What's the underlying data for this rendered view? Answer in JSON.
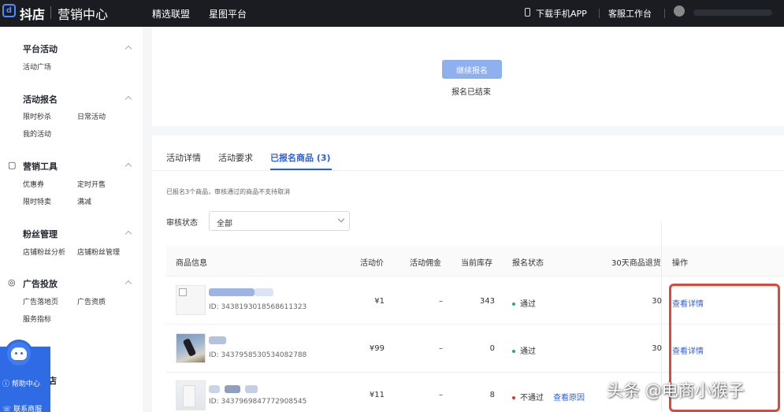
{
  "topbar": {
    "brand": "抖店",
    "brand_logo_char": "d",
    "section": "营销中心",
    "nav": [
      "精选联盟",
      "星图平台"
    ],
    "download_app": "下载手机APP",
    "service_desk": "客服工作台"
  },
  "sidebar": {
    "platform_activity": {
      "title": "平台活动",
      "items": [
        "活动广场"
      ]
    },
    "activity_signup": {
      "title": "活动报名",
      "items": [
        "限时秒杀",
        "日常活动",
        "我的活动"
      ]
    },
    "marketing_tools": {
      "title": "营销工具",
      "items": [
        "优惠券",
        "定时开售",
        "限时特卖",
        "满减"
      ]
    },
    "fan_management": {
      "title": "粉丝管理",
      "items": [
        "店铺粉丝分析",
        "店铺粉丝管理"
      ]
    },
    "ad_delivery": {
      "title": "广告投放",
      "items": [
        "广告落地页",
        "广告资质",
        "服务指标"
      ]
    },
    "partial_label": "店",
    "help": {
      "help_center": "帮助中心",
      "contact": "联系商服"
    }
  },
  "top_card": {
    "continue_button": "继续报名",
    "status_text": "报名已结束"
  },
  "tabs": [
    {
      "label": "活动详情"
    },
    {
      "label": "活动要求"
    },
    {
      "label": "已报名商品 (3)"
    }
  ],
  "notice": "已报名3个商品，审核通过的商品不支持取消",
  "filter": {
    "label": "审核状态",
    "value": "全部"
  },
  "table": {
    "columns": [
      "商品信息",
      "活动价",
      "活动佣金",
      "当前库存",
      "报名状态",
      "30天商品退货",
      "操作"
    ],
    "rows": [
      {
        "id": "ID: 3438193018568611323",
        "price": "¥1",
        "commission": "–",
        "stock": "343",
        "status": "通过",
        "status_type": "ok",
        "refund": "30",
        "action": "查看详情"
      },
      {
        "id": "ID: 3437958530534082788",
        "price": "¥99",
        "commission": "–",
        "stock": "0",
        "status": "通过",
        "status_type": "ok",
        "refund": "30",
        "action": "查看详情"
      },
      {
        "id": "ID: 3437969847772908545",
        "price": "¥11",
        "commission": "–",
        "stock": "8",
        "status": "不通过",
        "status_type": "no",
        "reason_link": "查看原因"
      }
    ]
  },
  "watermark": "头条 @电商小猴子",
  "colors": {
    "accent": "#2b5fe0",
    "topbar": "#1a1c21",
    "highlight_box": "#d94a3a",
    "ok": "#25b35a",
    "fail": "#e2362f"
  }
}
